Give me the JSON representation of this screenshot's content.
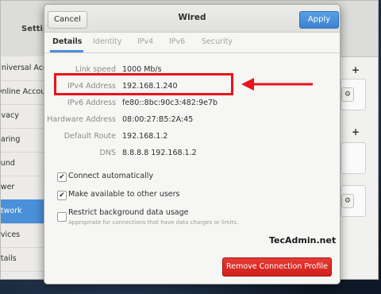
{
  "background": {
    "settings_title": "Settin",
    "sidebar_items": [
      {
        "label": "Universal Acce",
        "active": false
      },
      {
        "label": "Online Accoun",
        "active": false
      },
      {
        "label": "rivacy",
        "active": false
      },
      {
        "label": "haring",
        "active": false
      },
      {
        "label": "ound",
        "active": false
      },
      {
        "label": "ower",
        "active": false
      },
      {
        "label": "etwork",
        "active": true
      },
      {
        "label": "evices",
        "active": false
      },
      {
        "label": "etails",
        "active": false
      }
    ],
    "plus_icon": "+"
  },
  "dialog": {
    "title": "Wired",
    "cancel_label": "Cancel",
    "apply_label": "Apply",
    "tabs": [
      "Details",
      "Identity",
      "IPv4",
      "IPv6",
      "Security"
    ],
    "active_tab": "Details",
    "details": [
      {
        "label": "Link speed",
        "value": "1000 Mb/s"
      },
      {
        "label": "IPv4 Address",
        "value": "192.168.1.240"
      },
      {
        "label": "IPv6 Address",
        "value": "fe80::8bc:90c3:482:9e7b"
      },
      {
        "label": "Hardware Address",
        "value": "08:00:27:B5:2A:45"
      },
      {
        "label": "Default Route",
        "value": "192.168.1.2"
      },
      {
        "label": "DNS",
        "value": "8.8.8.8 192.168.1.2"
      }
    ],
    "options": {
      "connect_automatically": {
        "label": "Connect automatically",
        "checked": true
      },
      "available_to_others": {
        "label": "Make available to other users",
        "checked": true
      },
      "restrict_background": {
        "label": "Restrict background data usage",
        "note": "Appropriate for connections that have data charges or limits.",
        "checked": false
      }
    },
    "watermark": "TecAdmin.net",
    "remove_label": "Remove Connection Profile"
  },
  "colors": {
    "accent": "#4a90d9",
    "danger": "#d9241e",
    "highlight": "#e8141a"
  }
}
